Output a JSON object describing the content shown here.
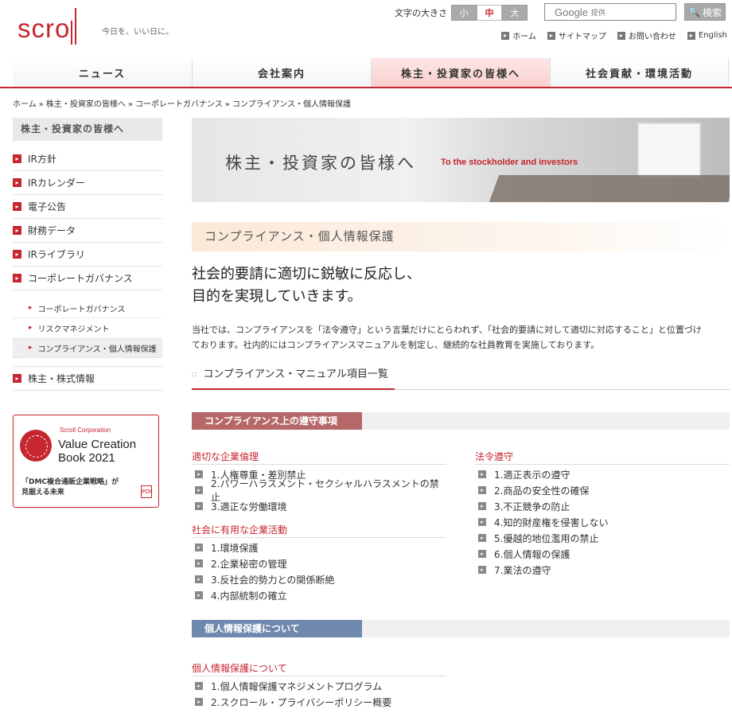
{
  "header": {
    "logo": "scroll",
    "tagline": "今日を、いい日に。",
    "font_size_label": "文字の大きさ",
    "font_sizes": [
      "小",
      "中",
      "大"
    ],
    "search_brand": "Google",
    "search_brand_sub": "提供",
    "search_button": "検索",
    "util_links": [
      "ホーム",
      "サイトマップ",
      "お問い合わせ",
      "English"
    ]
  },
  "nav": [
    "ニュース",
    "会社案内",
    "株主・投資家の皆様へ",
    "社会貢献・環境活動"
  ],
  "breadcrumb": [
    "ホーム",
    "株主・投資家の皆様へ",
    "コーポレートガバナンス",
    "コンプライアンス・個人情報保護"
  ],
  "sidebar": {
    "heading": "株主・投資家の皆様へ",
    "items": [
      "IR方針",
      "IRカレンダー",
      "電子公告",
      "財務データ",
      "IRライブラリ",
      "コーポレートガバナンス"
    ],
    "sub_items": [
      "コーポレートガバナンス",
      "リスクマネジメント",
      "コンプライアンス・個人情報保護"
    ],
    "last_item": "株主・株式情報",
    "banner": {
      "corp": "Scroll Corporation",
      "title_line1": "Value Creation",
      "title_line2": "Book 2021",
      "sub_line1": "「DMC複合通販企業戦略」が",
      "sub_line2": "見据える未来",
      "pdf_label": "PDF"
    }
  },
  "hero": {
    "title": "株主・投資家の皆様へ",
    "subtitle": "To the stockholder and investors"
  },
  "section_title": "コンプライアンス・個人情報保護",
  "lead_line1": "社会的要請に適切に鋭敏に反応し、",
  "lead_line2": "目的を実現していきます。",
  "body_line1": "当社では、コンプライアンスを「法令遵守」という言葉だけにとらわれず、「社会的要請に対して適切に対応すること」と位置づけ",
  "body_line2": "ております。社内的にはコンプライアンスマニュアルを制定し、継続的な社員教育を実施しております。",
  "list_heading": "コンプライアンス・マニュアル項目一覧",
  "categories": {
    "compliance": "コンプライアンス上の遵守事項",
    "privacy": "個人情報保護について"
  },
  "groups": {
    "ethics": {
      "title": "適切な企業倫理",
      "items": [
        "1.人権尊重・差別禁止",
        "2.パワーハラスメント・セクシャルハラスメントの禁止",
        "3.適正な労働環境"
      ]
    },
    "social": {
      "title": "社会に有用な企業活動",
      "items": [
        "1.環境保護",
        "2.企業秘密の管理",
        "3.反社会的勢力との関係断絶",
        "4.内部統制の確立"
      ]
    },
    "law": {
      "title": "法令遵守",
      "items": [
        "1.適正表示の遵守",
        "2.商品の安全性の確保",
        "3.不正競争の防止",
        "4.知的財産権を侵害しない",
        "5.優越的地位濫用の禁止",
        "6.個人情報の保護",
        "7.業法の遵守"
      ]
    },
    "privacy": {
      "title": "個人情報保護について",
      "items": [
        "1.個人情報保護マネジメントプログラム",
        "2.スクロール・プライバシーポリシー概要"
      ]
    }
  }
}
